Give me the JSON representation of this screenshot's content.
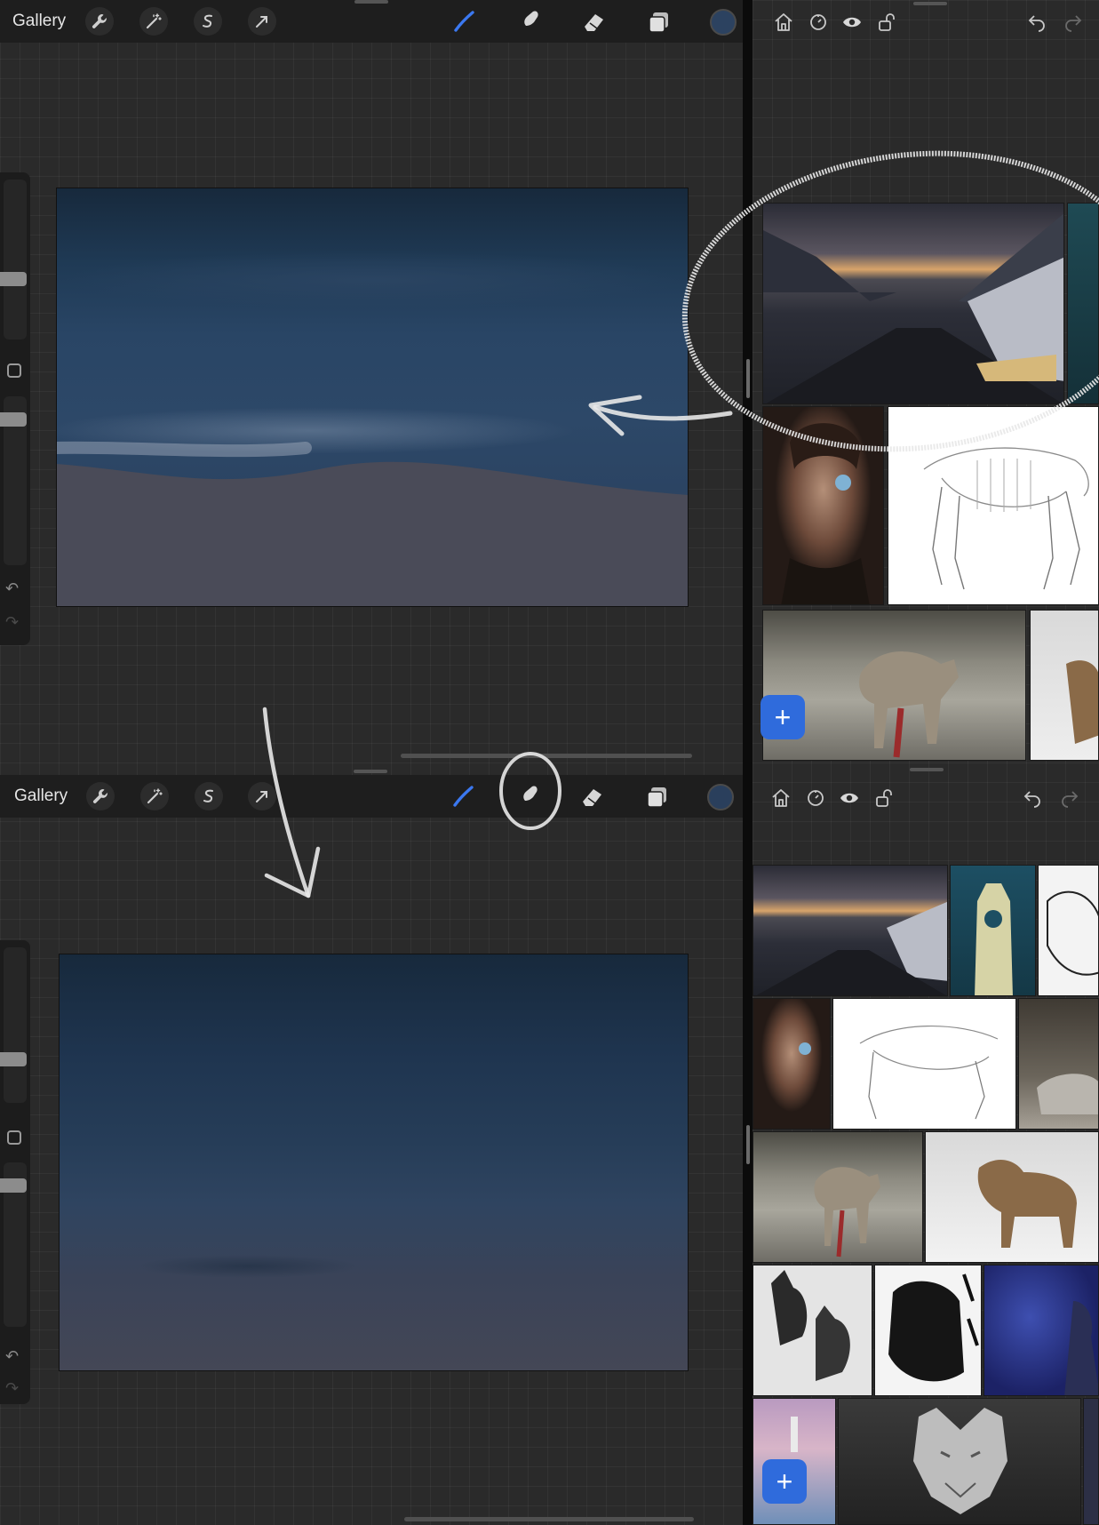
{
  "top_app": {
    "toolbar": {
      "gallery_label": "Gallery",
      "color": "#2c4260"
    }
  },
  "bottom_app": {
    "toolbar": {
      "gallery_label": "Gallery",
      "color": "#2a3f5c"
    }
  },
  "colors": {
    "accent_blue": "#3b78f0",
    "add_button": "#2f6bdc",
    "annotation": "#e8e8e8",
    "sky_top": "#17293c",
    "sky_bottom": "#4a4c58"
  },
  "reference_top": {
    "add_button_label": "+",
    "images": [
      "mountain-road",
      "teal-figure",
      "portrait-man",
      "wolf-skeleton-sketch",
      "wolf-on-ice",
      "wolf-in-snow"
    ]
  },
  "reference_bottom": {
    "add_button_label": "+",
    "images": [
      "mountain-road",
      "hazmat-figure",
      "wolf-ink-drawing",
      "portrait-man",
      "wolf-skeleton-sketch",
      "wolf-lying",
      "wolf-on-ice",
      "wolf-in-snow",
      "dog-portraits",
      "manga-wolf",
      "blue-warrior",
      "pink-lighthouse",
      "wolf-head-sculpture",
      "edge-thumb"
    ]
  }
}
